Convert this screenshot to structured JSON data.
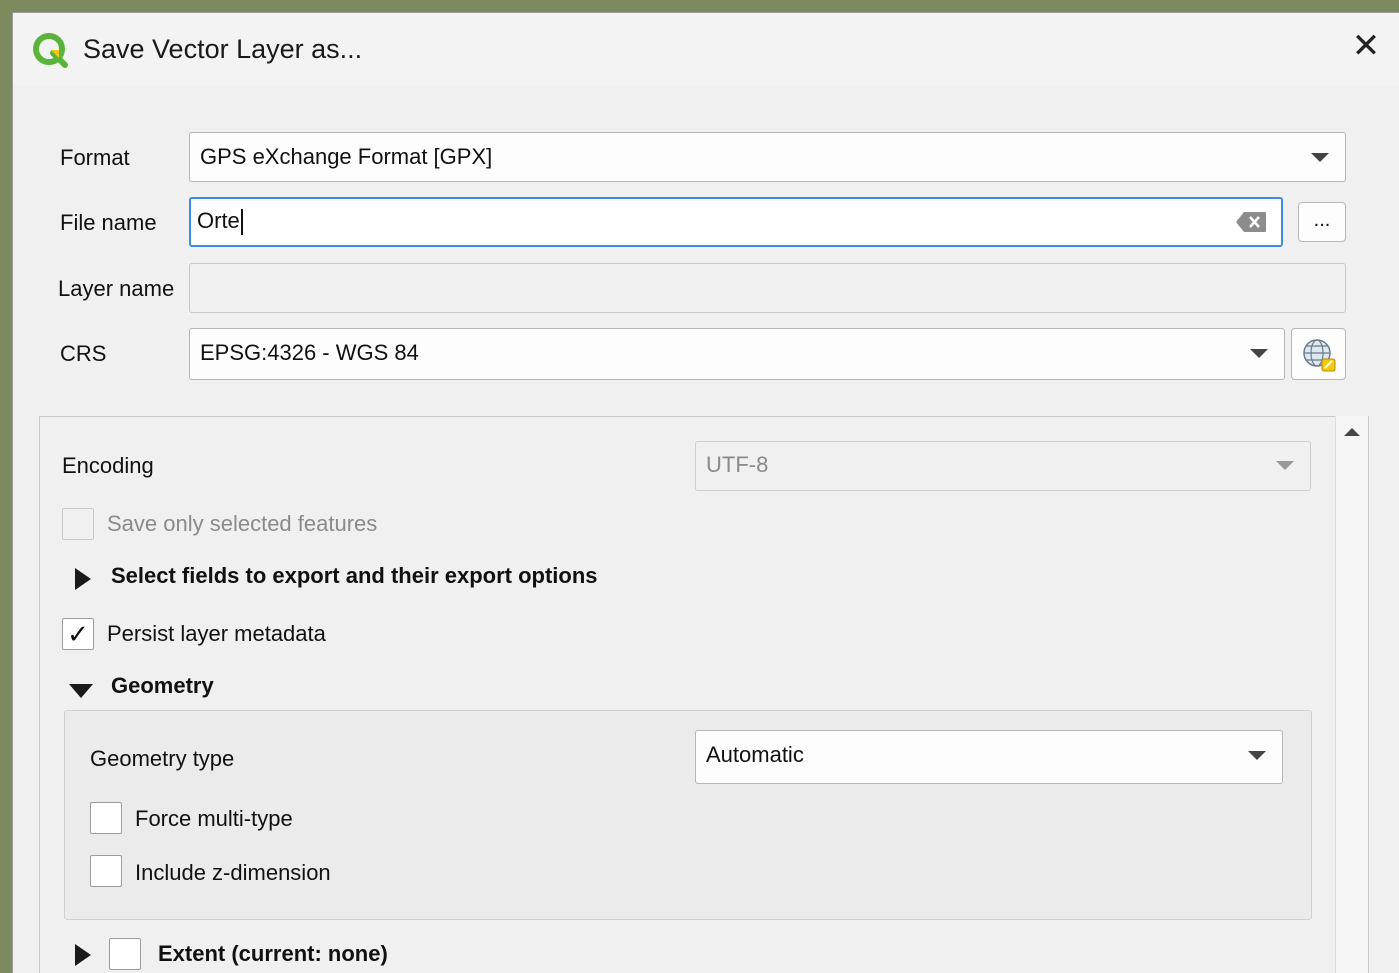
{
  "window": {
    "title": "Save Vector Layer as...",
    "close_glyph": "✕"
  },
  "form": {
    "format": {
      "label": "Format",
      "value": "GPS eXchange Format [GPX]"
    },
    "file_name": {
      "label": "File name",
      "value": "Orte",
      "browse_label": "..."
    },
    "layer_name": {
      "label": "Layer name",
      "value": ""
    },
    "crs": {
      "label": "CRS",
      "value": "EPSG:4326 - WGS 84"
    }
  },
  "options": {
    "encoding": {
      "label": "Encoding",
      "value": "UTF-8"
    },
    "save_selected": {
      "label": "Save only selected features",
      "checked": false,
      "enabled": false
    },
    "select_fields": {
      "label": "Select fields to export and their export options",
      "expanded": false
    },
    "persist_metadata": {
      "label": "Persist layer metadata",
      "checked": true,
      "check_glyph": "✓"
    },
    "geometry": {
      "label": "Geometry",
      "expanded": true,
      "type_label": "Geometry type",
      "type_value": "Automatic",
      "force_multi": {
        "label": "Force multi-type",
        "checked": false
      },
      "include_z": {
        "label": "Include z-dimension",
        "checked": false
      }
    },
    "extent": {
      "label": "Extent (current: none)",
      "checked": false,
      "expanded": false
    }
  },
  "icons": {
    "app": "qgis-logo-icon",
    "clear": "clear-text-icon",
    "crs_selector": "globe-crs-icon"
  },
  "colors": {
    "accent": "#3a8ee0",
    "qgis_green": "#5ab33a",
    "qgis_yellow": "#f2c811"
  }
}
